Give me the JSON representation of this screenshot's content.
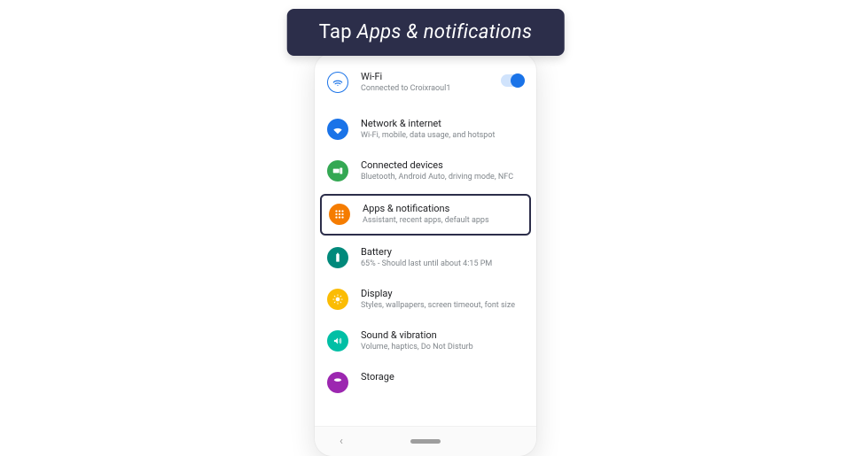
{
  "instruction": {
    "prefix": "Tap ",
    "emphasis": "Apps & notifications"
  },
  "settings": {
    "wifi": {
      "title": "Wi-Fi",
      "subtitle": "Connected to Croixraoul1"
    },
    "network": {
      "title": "Network & internet",
      "subtitle": "Wi-Fi, mobile, data usage, and hotspot"
    },
    "connected": {
      "title": "Connected devices",
      "subtitle": "Bluetooth, Android Auto, driving mode, NFC"
    },
    "apps": {
      "title": "Apps & notifications",
      "subtitle": "Assistant, recent apps, default apps"
    },
    "battery": {
      "title": "Battery",
      "subtitle": "65% - Should last until about 4:15 PM"
    },
    "display": {
      "title": "Display",
      "subtitle": "Styles, wallpapers, screen timeout, font size"
    },
    "sound": {
      "title": "Sound & vibration",
      "subtitle": "Volume, haptics, Do Not Disturb"
    },
    "storage": {
      "title": "Storage",
      "subtitle": ""
    }
  }
}
